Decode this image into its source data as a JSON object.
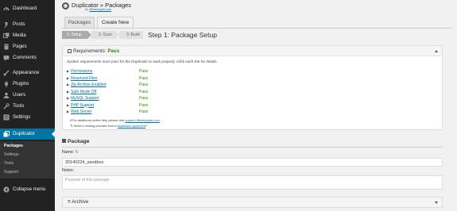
{
  "sidebar": {
    "items": [
      {
        "label": "Dashboard",
        "icon": "dashboard-icon"
      },
      {
        "label": "Posts",
        "icon": "pin-icon"
      },
      {
        "label": "Media",
        "icon": "media-icon"
      },
      {
        "label": "Pages",
        "icon": "page-icon"
      },
      {
        "label": "Comments",
        "icon": "comment-icon"
      },
      {
        "label": "Appearance",
        "icon": "brush-icon"
      },
      {
        "label": "Plugins",
        "icon": "plug-icon"
      },
      {
        "label": "Users",
        "icon": "user-icon"
      },
      {
        "label": "Tools",
        "icon": "wrench-icon"
      },
      {
        "label": "Settings",
        "icon": "settings-icon"
      },
      {
        "label": "Duplicator",
        "icon": "duplicator-icon"
      }
    ],
    "submenu": [
      "Packages",
      "Settings",
      "Tools",
      "Support"
    ],
    "collapse": "Collapse menu"
  },
  "header": {
    "title": "Duplicator » Packages",
    "byline_prefix": "By ",
    "byline_link": "lifeinthegrid.com"
  },
  "tabs": [
    "Packages",
    "Create New"
  ],
  "steps": {
    "items": [
      "1: Setup",
      "2: Scan",
      "3: Build"
    ],
    "title": "Step 1: Package Setup"
  },
  "requirements": {
    "title_prefix": "Requirements: ",
    "status": "Pass",
    "intro": "System requirements must pass for the Duplicator to work properly. Click each link for details.",
    "rows": [
      {
        "name": "Permissions",
        "value": "Pass"
      },
      {
        "name": "Reserved Files",
        "value": "Pass"
      },
      {
        "name": "Zip Archive Enabled",
        "value": "Pass"
      },
      {
        "name": "Safe Mode Off",
        "value": "Pass"
      },
      {
        "name": "MySQL Support",
        "value": "Pass"
      },
      {
        "name": "PHP Support",
        "value": "Pass"
      },
      {
        "name": "Web Server",
        "value": "Pass"
      }
    ],
    "note1_prefix": "For additional online help please visit ",
    "note1_link": "support.lifeinthegrid.com",
    "note2_prefix": "Need a hosting provider that is ",
    "note2_link": "duplicator approved",
    "note2_suffix": "?"
  },
  "package": {
    "section_title": "Package",
    "name_label": "Name:",
    "name_value": "20140224_sandbox",
    "notes_label": "Notes:",
    "notes_placeholder": "Purpose of this package"
  },
  "archive": {
    "title": "Archive"
  },
  "colors": {
    "accent": "#0074a2",
    "pass": "#2e8b00",
    "sidebar": "#222222"
  }
}
